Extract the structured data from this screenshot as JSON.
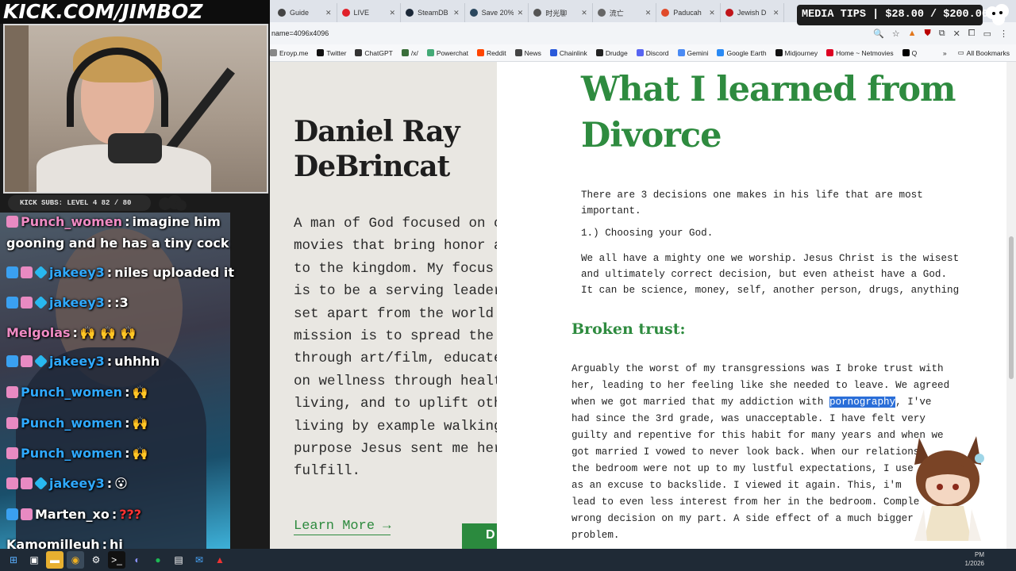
{
  "browser": {
    "tabs": [
      {
        "label": "Guide",
        "color": "#444"
      },
      {
        "label": "LIVE",
        "color": "#e0202a"
      },
      {
        "label": "SteamDB",
        "color": "#1b2838"
      },
      {
        "label": "Save 20%",
        "color": "#2a475e"
      },
      {
        "label": "时光聊",
        "color": "#555"
      },
      {
        "label": "流亡",
        "color": "#666"
      },
      {
        "label": "Paducah",
        "color": "#e04a2a"
      },
      {
        "label": "Jewish D",
        "color": "#c0141a"
      }
    ],
    "url": "name=4096x4096",
    "bookmarks": [
      {
        "label": "Eroyp.me",
        "color": "#888"
      },
      {
        "label": "Twitter",
        "color": "#111"
      },
      {
        "label": "ChatGPT",
        "color": "#333"
      },
      {
        "label": "/x/",
        "color": "#3a6e3a"
      },
      {
        "label": "Powerchat",
        "color": "#4a7"
      },
      {
        "label": "Reddit",
        "color": "#ff4500"
      },
      {
        "label": "News",
        "color": "#444"
      },
      {
        "label": "Chainlink",
        "color": "#2a5ada"
      },
      {
        "label": "Drudge",
        "color": "#222"
      },
      {
        "label": "Discord",
        "color": "#5865f2"
      },
      {
        "label": "Gemini",
        "color": "#4a8af4"
      },
      {
        "label": "Google Earth",
        "color": "#2a8af4"
      },
      {
        "label": "Midjourney",
        "color": "#111"
      },
      {
        "label": "Home ~ Netmovies",
        "color": "#d02"
      },
      {
        "label": "Q",
        "color": "#000"
      }
    ],
    "bookmarks_more": "»",
    "all_bookmarks": "All Bookmarks"
  },
  "page": {
    "author_name": "Daniel Ray\nDeBrincat",
    "author_bio": "A man of God focused on cr\nmovies that bring honor ar\nto the kingdom. My focus e\nis to be a serving leader\nset apart from the world.\nmission is to spread the g\nthrough art/film, educate\non wellness through health\nliving, and to uplift othe\nliving by example walking\npurpose Jesus sent me here\nfulfill.",
    "learn_more": "Learn More →",
    "green_button": "D",
    "article_title": "What I learned from\nDivorce",
    "intro": "There are 3 decisions one makes in his life that are most\nimportant.",
    "point1": "1.) Choosing your God.",
    "point1_body": "We all have a mighty one we worship. Jesus Christ is the wisest\nand ultimately correct decision, but even atheist have a God.\nIt can be science, money, self, another person, drugs, anything",
    "section_heading": "Broken trust:",
    "body_lines": [
      {
        "pre": "Arguably the worst of my transgressions was I broke trust with",
        "hl": "",
        "post": ""
      },
      {
        "pre": "her, leading to her feeling like she needed to leave. We agreed",
        "hl": "",
        "post": ""
      },
      {
        "pre": "when we got married that my addiction with ",
        "hl": "pornography",
        "post": ", I've"
      },
      {
        "pre": "had since the 3rd grade, was unacceptable. I have felt very",
        "hl": "",
        "post": ""
      },
      {
        "pre": "guilty and repentive for this habit for many years and when we",
        "hl": "",
        "post": ""
      },
      {
        "pre": "got married I vowed to never look back. When our relations",
        "hl": "",
        "post": ""
      },
      {
        "pre": "the bedroom were not up to my lustful expectations, I use",
        "hl": "",
        "post": ""
      },
      {
        "pre": "as an excuse to backslide. I viewed it again. This, i'm",
        "hl": "",
        "post": ""
      },
      {
        "pre": "lead to even less interest from her in the bedroom. Comple",
        "hl": "",
        "post": ""
      },
      {
        "pre": "wrong decision on my part. A side effect of a much bigger",
        "hl": "",
        "post": ""
      },
      {
        "pre": "problem.",
        "hl": "",
        "post": ""
      }
    ]
  },
  "stream": {
    "kick_logo": "KICK.COM/JIMBOZ",
    "media_tips": "MEDIA TIPS | $28.00 / $200.00",
    "media_tips_progress": 0.14,
    "sub_bar": "KICK SUBS: LEVEL 4 82 / 80"
  },
  "chat": [
    {
      "user": "Punch_women",
      "user_color": "pink",
      "badges": [
        "pink"
      ],
      "text": "imagine him",
      "text_color": "white",
      "cont": "gooning and he has a tiny cock"
    },
    {
      "user": "jakeey3",
      "user_color": "blue",
      "badges": [
        "blue",
        "pink",
        "gem"
      ],
      "text": "niles uploaded it",
      "text_color": "white",
      "cont": ""
    },
    {
      "user": "jakeey3",
      "user_color": "blue",
      "badges": [
        "blue",
        "pink",
        "gem"
      ],
      "text": ":3",
      "text_color": "white",
      "cont": ""
    },
    {
      "user": "Melgolas",
      "user_color": "pink",
      "badges": [],
      "text": "🙌  🙌  🙌",
      "text_color": "white",
      "cont": ""
    },
    {
      "user": "jakeey3",
      "user_color": "blue",
      "badges": [
        "blue",
        "pink",
        "gem"
      ],
      "text": "uhhhh",
      "text_color": "white",
      "cont": ""
    },
    {
      "user": "Punch_women",
      "user_color": "blue",
      "badges": [
        "pink"
      ],
      "text": "🙌",
      "text_color": "white",
      "cont": ""
    },
    {
      "user": "Punch_women",
      "user_color": "blue",
      "badges": [
        "pink"
      ],
      "text": "🙌",
      "text_color": "white",
      "cont": ""
    },
    {
      "user": "Punch_women",
      "user_color": "blue",
      "badges": [
        "pink"
      ],
      "text": "🙌",
      "text_color": "white",
      "cont": ""
    },
    {
      "user": "jakeey3",
      "user_color": "blue",
      "badges": [
        "pink",
        "pink",
        "gem"
      ],
      "text": "😮",
      "text_color": "white",
      "cont": ""
    },
    {
      "user": "Marten_xo",
      "user_color": "white",
      "badges": [
        "blue",
        "pink"
      ],
      "text": "???",
      "text_color": "red",
      "cont": ""
    },
    {
      "user": "Kamomilleuh",
      "user_color": "white",
      "badges": [],
      "text": "hi",
      "text_color": "white",
      "cont": ""
    }
  ],
  "taskbar": {
    "clock_time": "PM",
    "clock_date": "1/2026"
  }
}
